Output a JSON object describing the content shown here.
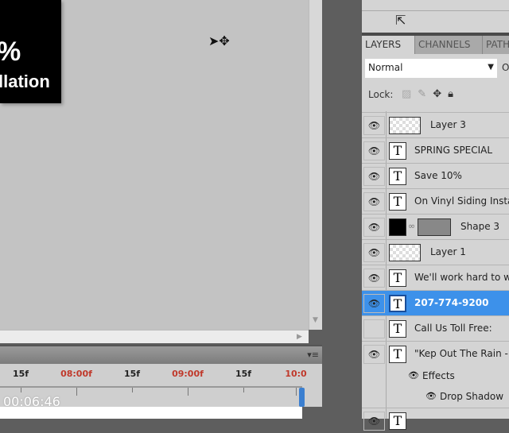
{
  "canvas": {
    "art_line1": "%",
    "art_line2": "llation"
  },
  "timeline": {
    "ticks": [
      {
        "label": "15f",
        "major": false
      },
      {
        "label": "08:00f",
        "major": true
      },
      {
        "label": "15f",
        "major": false
      },
      {
        "label": "09:00f",
        "major": true
      },
      {
        "label": "15f",
        "major": false
      },
      {
        "label": "10:0",
        "major": true
      }
    ],
    "timecode": "00:06:46",
    "major_color": "#c0392b"
  },
  "panel": {
    "tabs": [
      "LAYERS",
      "CHANNELS",
      "PATH"
    ],
    "blend_mode": "Normal",
    "opacity_label": "O",
    "lock_label": "Lock:",
    "selection_color": "#3d91ea",
    "layers": [
      {
        "name": "Layer 3",
        "type": "raster",
        "visible": true
      },
      {
        "name": "SPRING SPECIAL",
        "type": "text",
        "visible": true
      },
      {
        "name": "Save 10%",
        "type": "text",
        "visible": true
      },
      {
        "name": "On Vinyl Siding Insta",
        "type": "text",
        "visible": true
      },
      {
        "name": "Shape 3",
        "type": "shape",
        "visible": true
      },
      {
        "name": "Layer 1",
        "type": "raster",
        "visible": true
      },
      {
        "name": "We'll work hard to w",
        "type": "text",
        "visible": true
      },
      {
        "name": "207-774-9200",
        "type": "text",
        "visible": true,
        "selected": true
      },
      {
        "name": "Call Us Toll Free:",
        "type": "text",
        "visible": false
      },
      {
        "name": "\"Kep Out The Rain - (",
        "type": "text",
        "visible": true
      },
      {
        "name": "Effects",
        "type": "effects",
        "visible": true
      },
      {
        "name": "Drop Shadow",
        "type": "effect",
        "visible": true
      },
      {
        "name": "",
        "type": "text",
        "visible": true
      }
    ]
  }
}
